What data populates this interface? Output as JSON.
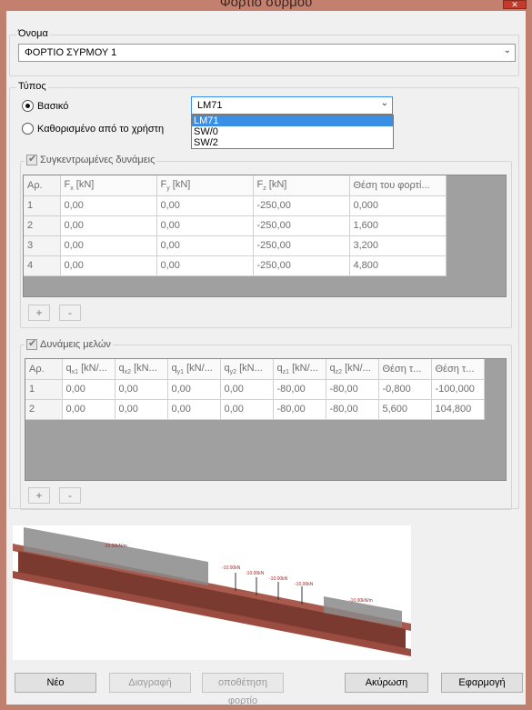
{
  "window": {
    "title": "Φορτίο συρμού",
    "close_glyph": "✕"
  },
  "name_group": {
    "label": "Όνομα",
    "value": "ΦΟΡΤΙΟ ΣΥΡΜΟΥ 1"
  },
  "type_group": {
    "label": "Τύπος",
    "radio_basic": "Βασικό",
    "radio_user": "Καθορισμένο από το χρήστη",
    "combo_value": "LM71",
    "options": [
      "LM71",
      "SW/0",
      "SW/2"
    ]
  },
  "forces_group": {
    "label": "Συγκεντρωμένες δυνάμεις",
    "columns": [
      "Αρ.",
      "F",
      "F",
      "F",
      "Θέση του φορτί..."
    ],
    "col_subs": [
      "",
      "x",
      "y",
      "z",
      ""
    ],
    "col_units": [
      "",
      " [kN]",
      " [kN]",
      " [kN]",
      ""
    ],
    "rows": [
      [
        "1",
        "0,00",
        "0,00",
        "-250,00",
        "0,000"
      ],
      [
        "2",
        "0,00",
        "0,00",
        "-250,00",
        "1,600"
      ],
      [
        "3",
        "0,00",
        "0,00",
        "-250,00",
        "3,200"
      ],
      [
        "4",
        "0,00",
        "0,00",
        "-250,00",
        "4,800"
      ]
    ],
    "add_label": "+",
    "remove_label": "-"
  },
  "members_group": {
    "label": "Δυνάμεις μελών",
    "columns": [
      "Αρ.",
      "q",
      "q",
      "q",
      "q",
      "q",
      "q",
      "Θέση τ...",
      "Θέση τ..."
    ],
    "col_subs": [
      "",
      "x1",
      "x2",
      "y1",
      "y2",
      "z1",
      "z2",
      "",
      ""
    ],
    "col_units": [
      "",
      " [kN/...",
      " [kN...",
      " [kN/...",
      " [kN...",
      " [kN/...",
      " [kN/...",
      "",
      ""
    ],
    "rows": [
      [
        "1",
        "0,00",
        "0,00",
        "0,00",
        "0,00",
        "-80,00",
        "-80,00",
        "-0,800",
        "-100,000"
      ],
      [
        "2",
        "0,00",
        "0,00",
        "0,00",
        "0,00",
        "-80,00",
        "-80,00",
        "5,600",
        "104,800"
      ]
    ],
    "add_label": "+",
    "remove_label": "-"
  },
  "preview": {
    "labels": [
      "-10.00kN/m",
      "-10.00kN",
      "-10.00kN",
      "-10.00kN",
      "-10.00kN",
      "-10.00kN/m"
    ]
  },
  "buttons": {
    "new": "Νέο",
    "delete": "Διαγραφή",
    "save_load": "οποθέτηση φορτίο",
    "cancel": "Ακύρωση",
    "apply": "Εφαρμογή"
  }
}
